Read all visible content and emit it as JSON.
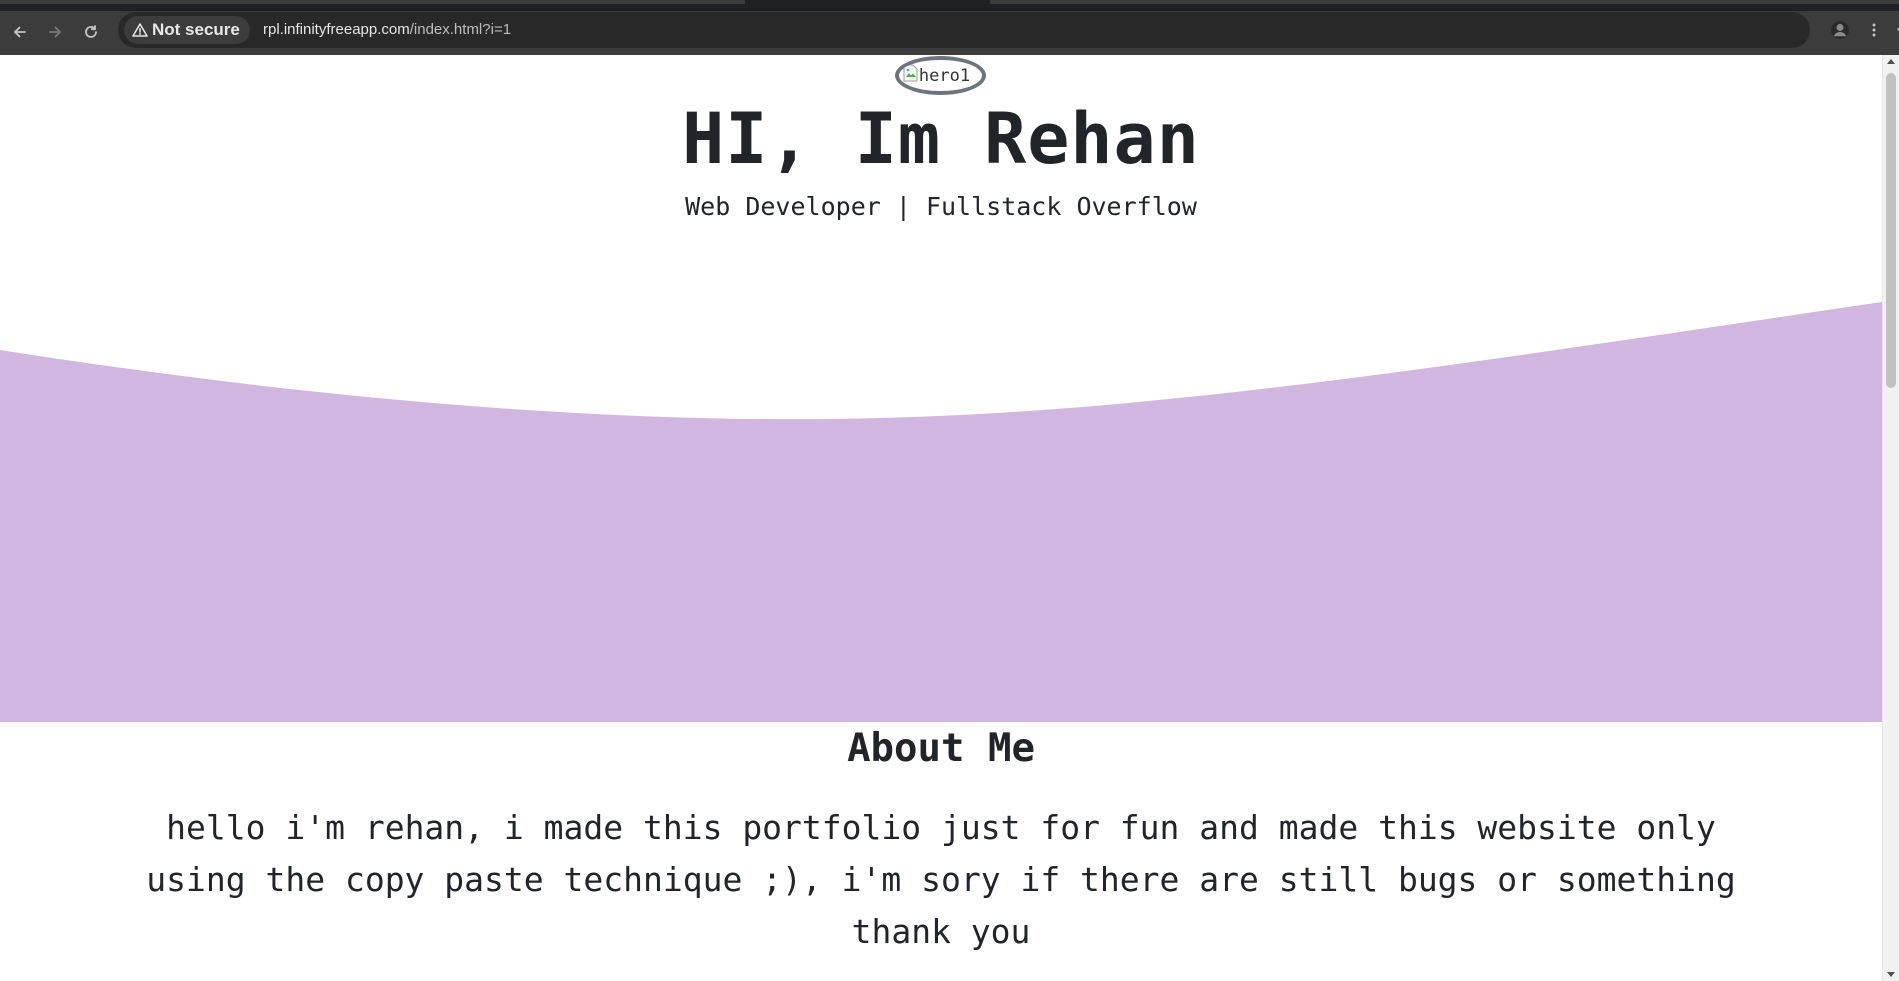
{
  "browser": {
    "security_label": "Not secure",
    "url_host": "rpl.infinityfreeapp.com",
    "url_path": "/index.html?i=1",
    "icons": {
      "back": "back-arrow-icon",
      "forward": "forward-arrow-icon",
      "reload": "reload-icon",
      "warning": "warning-triangle-icon",
      "bookmark": "star-icon",
      "profile": "profile-icon",
      "menu": "kebab-menu-icon"
    }
  },
  "hero": {
    "image_alt": "hero1",
    "title": "HI, Im Rehan",
    "subtitle": "Web Developer | Fullstack Overflow",
    "wave_color": "#d1b7e0"
  },
  "about": {
    "title": "About Me",
    "text": "hello i'm rehan, i made this portfolio just for fun and made this website only using the copy paste technique ;), i'm sory if there are still bugs or something thank you"
  },
  "colors": {
    "chrome_bg": "#3c3c3c",
    "omnibox_bg": "#282828",
    "text_dark": "#212529",
    "wave": "#d1b7e0",
    "img_border": "#6c757d"
  }
}
